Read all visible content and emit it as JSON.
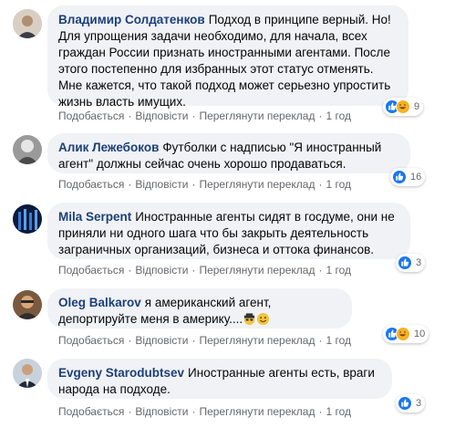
{
  "comments": [
    {
      "author": "Владимир Солдатенков",
      "text": "Подход в принципе верный. Но! Для упрощения задачи необходимо, для начала, всех граждан России признать иностранными агентами. После этого постепенно для избранных этот статус отменять. Мне кажется, что такой подход может серьезно упростить жизнь власть имущих.",
      "reaction_count": "9",
      "reactions": [
        "like",
        "haha"
      ],
      "actions": {
        "like": "Подобається",
        "reply": "Відповісти",
        "translate": "Переглянути переклад",
        "time": "1 год"
      }
    },
    {
      "author": "Алик Лежебоков",
      "text": "Футболки с надписью \"Я иностранный агент\" должны сейчас очень хорошо продаваться.",
      "reaction_count": "16",
      "reactions": [
        "like"
      ],
      "actions": {
        "like": "Подобається",
        "reply": "Відповісти",
        "translate": "Переглянути переклад",
        "time": "1 год"
      }
    },
    {
      "author": "Mila Serpent",
      "text": "Иностранные агенты сидят в госдуме, они не приняли ни одного шага что бы закрыть деятельность заграничных организаций, бизнеса и оттока финансов.",
      "reaction_count": "3",
      "reactions": [
        "like"
      ],
      "actions": {
        "like": "Подобається",
        "reply": "Відповісти",
        "translate": "Переглянути переклад",
        "time": "1 год"
      }
    },
    {
      "author": "Oleg Balkarov",
      "text": "я американский агент, депортируйте меня в америку....",
      "text_emojis": [
        "spy-emoji",
        "smile-emoji"
      ],
      "reaction_count": "10",
      "reactions": [
        "like",
        "haha"
      ],
      "actions": {
        "like": "Подобається",
        "reply": "Відповісти",
        "translate": "Переглянути переклад",
        "time": "1 год"
      }
    },
    {
      "author": "Evgeny Starodubtsev",
      "text": "Иностранные агенты есть, враги народа на подходе.",
      "reaction_count": "3",
      "reactions": [
        "like"
      ],
      "actions": {
        "like": "Подобається",
        "reply": "Відповісти",
        "translate": "Переглянути переклад",
        "time": "1 год"
      }
    }
  ],
  "colors": {
    "author": "#1c3f7a",
    "bubble": "#f0f2f5",
    "meta": "#65676b",
    "like": "#1877f2",
    "haha": "#f7b125"
  }
}
